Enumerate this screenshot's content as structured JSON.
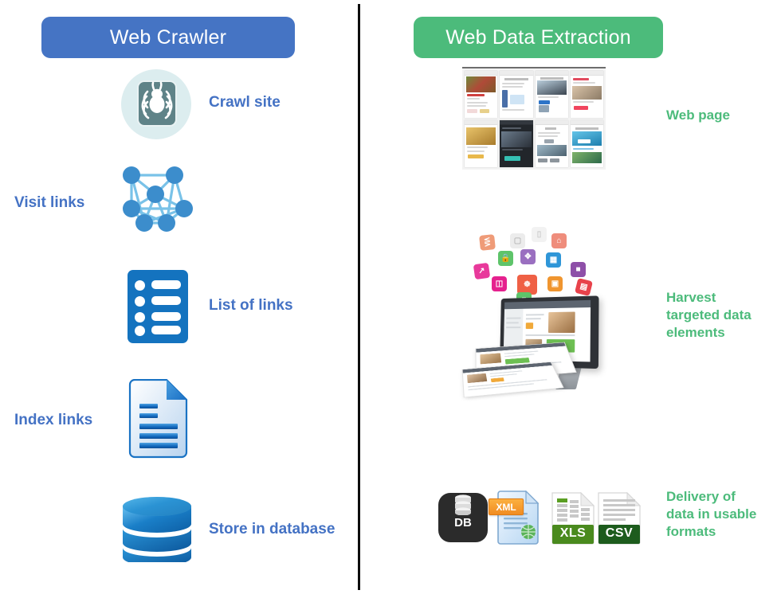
{
  "columns": {
    "left": {
      "header": "Web Crawler",
      "header_color": "#4574c4",
      "label_color": "#4472c4",
      "steps": [
        {
          "label": "Crawl site",
          "icon": "spider-icon"
        },
        {
          "label": "Visit links",
          "icon": "network-graph-icon"
        },
        {
          "label": "List of links",
          "icon": "list-icon"
        },
        {
          "label": "Index links",
          "icon": "document-icon"
        },
        {
          "label": "Store in database",
          "icon": "database-icon"
        }
      ]
    },
    "right": {
      "header": "Web Data Extraction",
      "header_color": "#4cbb7b",
      "label_color": "#4cbb7b",
      "steps": [
        {
          "label": "Web page",
          "icon": "webpage-grid-icon"
        },
        {
          "label": "Harvest\ntargeted data\nelements",
          "icon": "monitor-harvest-icon"
        },
        {
          "label": "Delivery of\ndata in usable\nformats",
          "icon": "data-formats-icon"
        }
      ]
    }
  },
  "formats": [
    {
      "name": "DB",
      "icon": "database-tile-icon",
      "color": "#2b2b2b"
    },
    {
      "name": "XML",
      "icon": "xml-file-icon",
      "color": "#f08c22"
    },
    {
      "name": "XLS",
      "icon": "xls-file-icon",
      "color": "#4a8a1e"
    },
    {
      "name": "CSV",
      "icon": "csv-file-icon",
      "color": "#1d5c1d"
    }
  ],
  "divider": {
    "icon": "vertical-divider",
    "color": "#0d0d0d"
  }
}
